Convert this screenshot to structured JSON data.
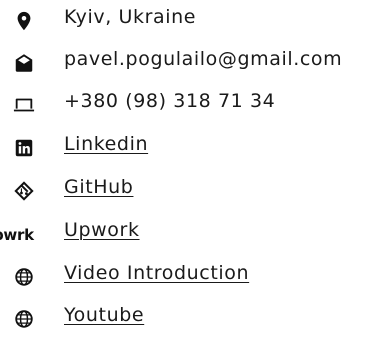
{
  "contacts": {
    "location": {
      "icon": "map-pin-icon",
      "text": "Kyiv, Ukraine"
    },
    "email": {
      "icon": "envelope-open-icon",
      "text": "pavel.pogulailo@gmail.com"
    },
    "phone": {
      "icon": "laptop-icon",
      "text": "+380 (98) 318 71 34"
    },
    "links": [
      {
        "icon": "linkedin-icon",
        "label": "Linkedin"
      },
      {
        "icon": "github-icon",
        "label": "GitHub"
      },
      {
        "icon": "upwork-logo",
        "logo_text": "pwrk",
        "label": "Upwork"
      },
      {
        "icon": "globe-icon",
        "label": "Video Introduction"
      },
      {
        "icon": "globe-icon",
        "label": "Youtube"
      }
    ]
  },
  "colors": {
    "text": "#1a1a1a",
    "icon": "#111111",
    "background": "#ffffff"
  }
}
